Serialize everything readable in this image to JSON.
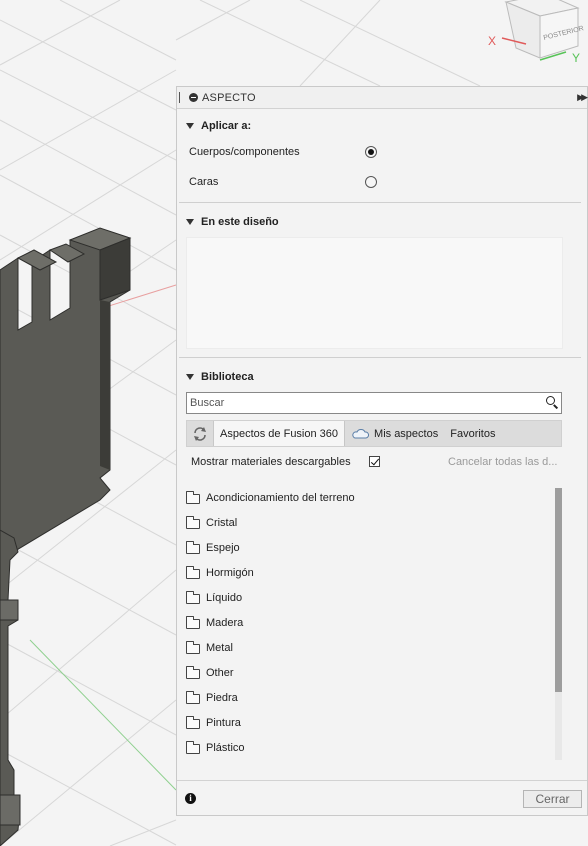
{
  "viewport": {
    "viewcube": {
      "face_label": "POSTERIOR",
      "axis_x": "X",
      "axis_y": "Y"
    }
  },
  "panel": {
    "title": "ASPECTO",
    "apply_section": {
      "heading": "Aplicar a:",
      "options": [
        {
          "label": "Cuerpos/componentes",
          "selected": true
        },
        {
          "label": "Caras",
          "selected": false
        }
      ]
    },
    "design_section": {
      "heading": "En este diseño"
    },
    "library_section": {
      "heading": "Biblioteca",
      "search_placeholder": "Buscar",
      "tabs": [
        "Aspectos de Fusion 360",
        "Mis aspectos",
        "Favoritos"
      ],
      "show_downloadable_label": "Mostrar materiales descargables",
      "show_downloadable_checked": true,
      "cancel_all_label": "Cancelar todas las d...",
      "folders": [
        "Acondicionamiento del terreno",
        "Cristal",
        "Espejo",
        "Hormigón",
        "Líquido",
        "Madera",
        "Metal",
        "Other",
        "Piedra",
        "Pintura",
        "Plástico"
      ]
    },
    "footer": {
      "close_label": "Cerrar"
    }
  }
}
